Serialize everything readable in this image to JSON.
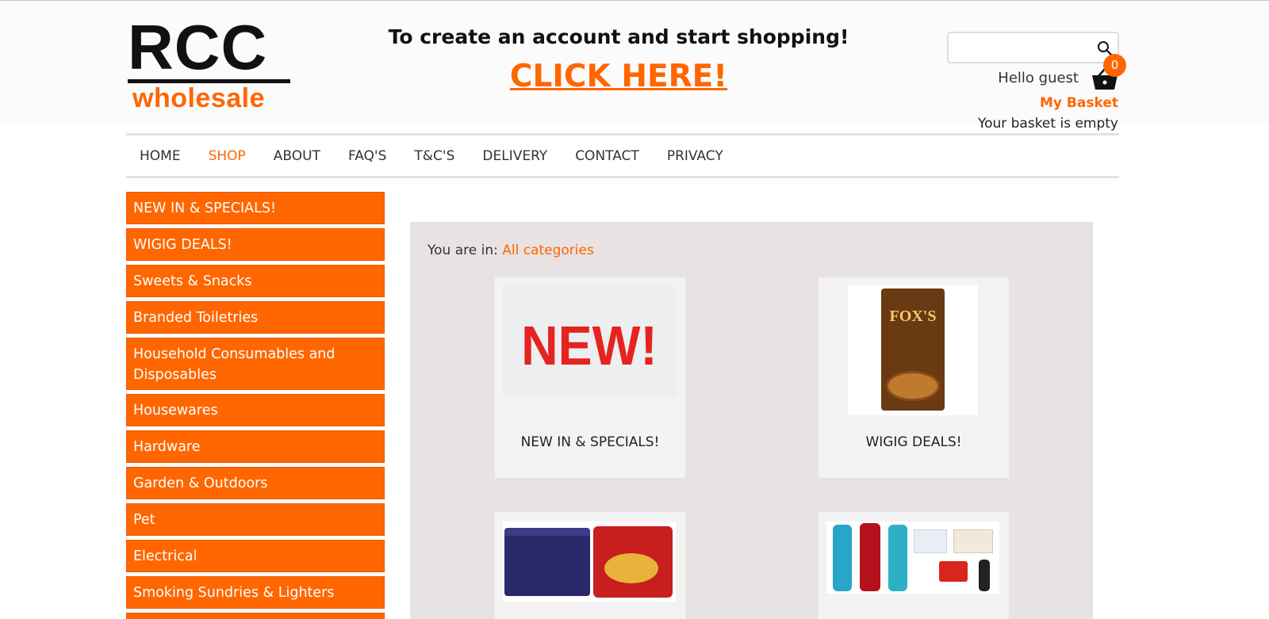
{
  "logo": {
    "main": "RCC",
    "sub": "wholesale"
  },
  "promo": {
    "title": "To create an account and start shopping!",
    "link": "CLICK HERE!"
  },
  "search": {
    "placeholder": "",
    "icon": "search-icon"
  },
  "account": {
    "greeting": "Hello guest",
    "basket_count": "0",
    "basket_label": "My Basket",
    "basket_status": "Your basket is empty",
    "basket_icon": "basket-icon"
  },
  "nav": {
    "items": [
      "HOME",
      "SHOP",
      "ABOUT",
      "FAQ'S",
      "T&C'S",
      "DELIVERY",
      "CONTACT",
      "PRIVACY"
    ],
    "active": "SHOP"
  },
  "sidebar": {
    "items": [
      "NEW IN & SPECIALS!",
      "WIGIG DEALS!",
      "Sweets & Snacks",
      "Branded Toiletries",
      "Household Consumables and Disposables",
      "Housewares",
      "Hardware",
      "Garden & Outdoors",
      "Pet",
      "Electrical",
      "Smoking Sundries & Lighters"
    ]
  },
  "breadcrumb": {
    "prefix": "You are in:",
    "link": "All categories"
  },
  "categories": [
    {
      "label": "NEW IN & SPECIALS!",
      "image_text": "NEW!"
    },
    {
      "label": "WIGIG DEALS!",
      "image_text": "FOX'S"
    },
    {
      "label": "",
      "image_text": ""
    },
    {
      "label": "",
      "image_text": ""
    }
  ],
  "colors": {
    "accent": "#ff6600",
    "panel": "#e8e2e2",
    "card": "#f3f3f3"
  }
}
